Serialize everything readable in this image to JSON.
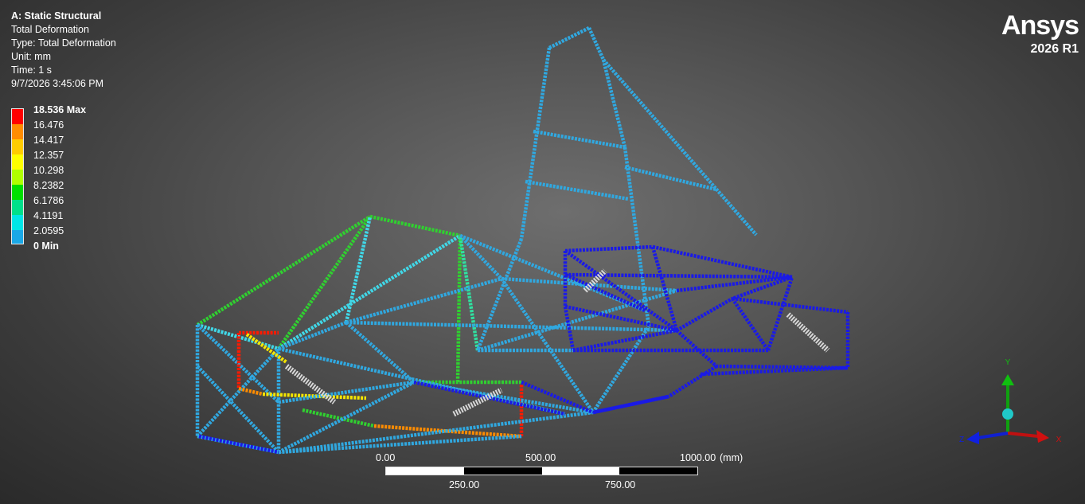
{
  "info": {
    "title": "A: Static Structural",
    "result": "Total Deformation",
    "type": "Type: Total Deformation",
    "unit": "Unit: mm",
    "time": "Time: 1 s",
    "timestamp": "9/7/2026 3:45:06 PM"
  },
  "legend": {
    "labels": [
      "18.536 Max",
      "16.476",
      "14.417",
      "12.357",
      "10.298",
      "8.2382",
      "6.1786",
      "4.1191",
      "2.0595",
      "0 Min"
    ],
    "colors": [
      "#ff0000",
      "#ff8c00",
      "#ffcc00",
      "#ffff00",
      "#b0ff00",
      "#00e000",
      "#00e08a",
      "#00e6e6",
      "#1aa8e6",
      "#0000ff"
    ]
  },
  "brand": {
    "name": "Ansys",
    "version": "2026 R1"
  },
  "scale": {
    "top_labels": [
      "0.00",
      "500.00",
      "1000.00",
      "(mm)"
    ],
    "bottom_labels": [
      "250.00",
      "750.00"
    ]
  },
  "triad": {
    "x": "X",
    "y": "Y",
    "z": "Z"
  }
}
